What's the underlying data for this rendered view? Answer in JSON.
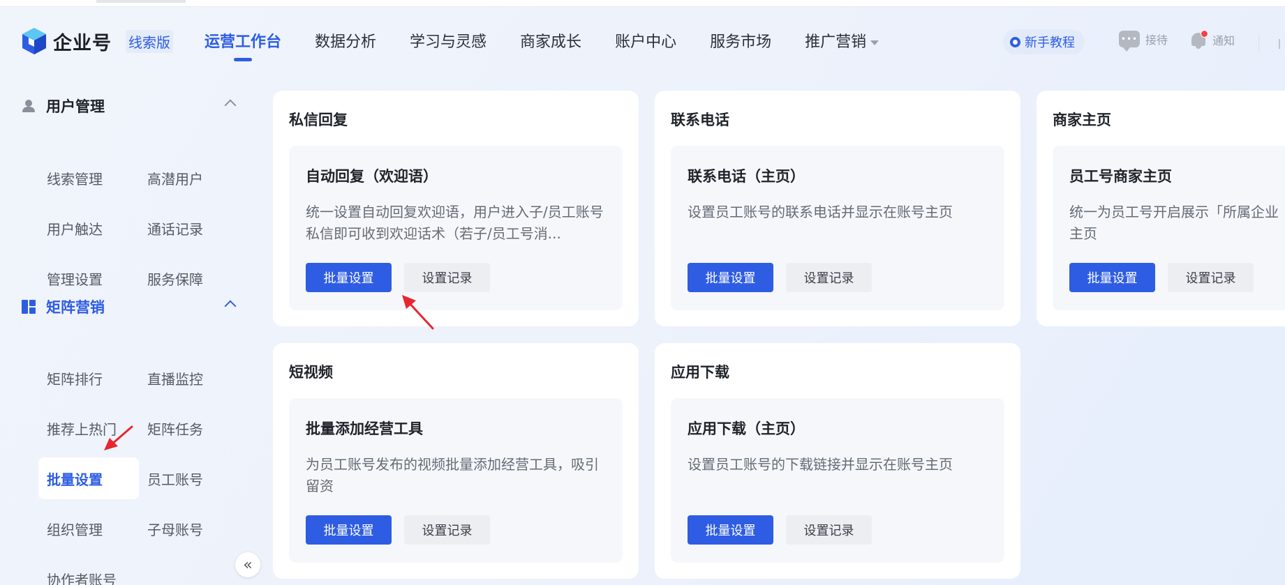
{
  "header": {
    "brand": "企业号",
    "edition": "线索版",
    "nav": [
      {
        "label": "运营工作台",
        "active": true
      },
      {
        "label": "数据分析"
      },
      {
        "label": "学习与灵感"
      },
      {
        "label": "商家成长"
      },
      {
        "label": "账户中心"
      },
      {
        "label": "服务市场"
      },
      {
        "label": "推广营销",
        "dropdown": true
      }
    ],
    "tutorial": "新手教程",
    "reception": "接待",
    "notice": "通知"
  },
  "sidebar": {
    "sections": [
      {
        "label": "用户管理",
        "icon": "user-icon",
        "items": [
          "线索管理",
          "高潜用户",
          "用户触达",
          "通话记录",
          "管理设置",
          "服务保障"
        ]
      },
      {
        "label": "矩阵营销",
        "icon": "grid-icon",
        "items": [
          "矩阵排行",
          "直播监控",
          "推荐上热门",
          "矩阵任务",
          "批量设置",
          "员工账号",
          "组织管理",
          "子母账号",
          "协作者账号"
        ]
      }
    ],
    "active_item": "批量设置"
  },
  "cards": [
    {
      "title": "私信回复",
      "item_title": "自动回复（欢迎语）",
      "desc": "统一设置自动回复欢迎语，用户进入子/员工账号私信即可收到欢迎话术（若子/员工号消...",
      "primary": "批量设置",
      "secondary": "设置记录"
    },
    {
      "title": "联系电话",
      "item_title": "联系电话（主页）",
      "desc": "设置员工账号的联系电话并显示在账号主页",
      "primary": "批量设置",
      "secondary": "设置记录"
    },
    {
      "title": "商家主页",
      "item_title": "员工号商家主页",
      "desc": "统一为员工号开启展示「所属企业主页",
      "primary": "批量设置",
      "secondary": "设置记录"
    },
    {
      "title": "短视频",
      "item_title": "批量添加经营工具",
      "desc": "为员工账号发布的视频批量添加经营工具，吸引留资",
      "primary": "批量设置",
      "secondary": "设置记录"
    },
    {
      "title": "应用下载",
      "item_title": "应用下载（主页）",
      "desc": "设置员工账号的下载链接并显示在账号主页",
      "primary": "批量设置",
      "secondary": "设置记录"
    }
  ],
  "colors": {
    "accent": "#2e5de3",
    "annotation": "#e8262d"
  }
}
